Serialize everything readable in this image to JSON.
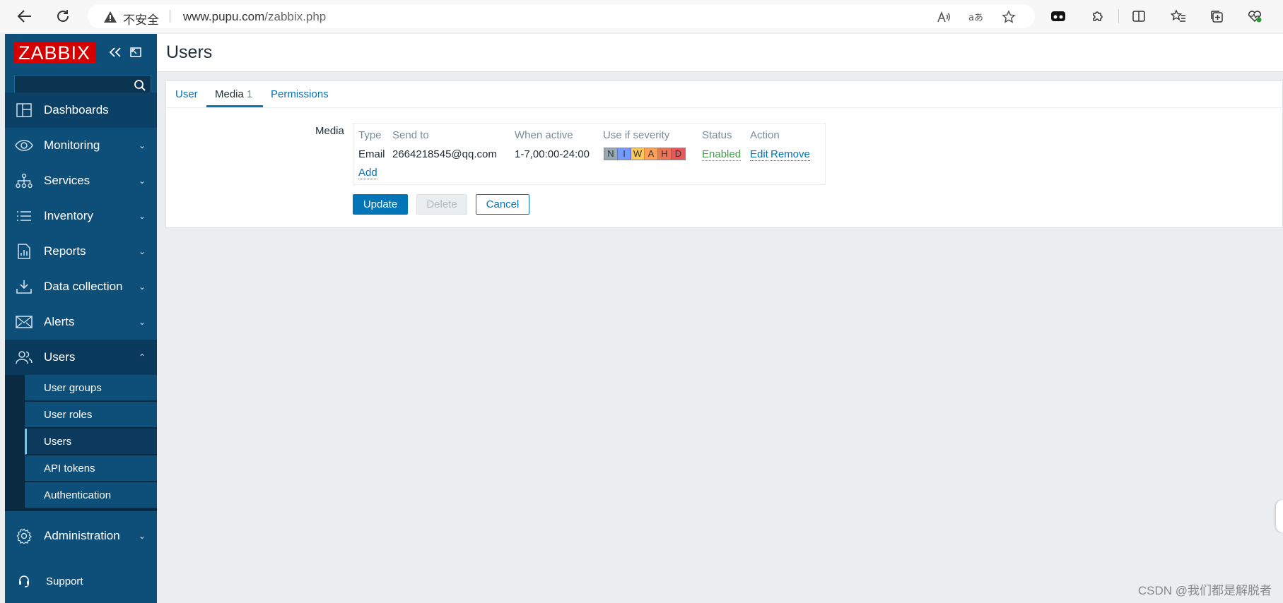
{
  "browser": {
    "security_label": "不安全",
    "url_host": "www.pupu.com",
    "url_path": "/zabbix.php"
  },
  "sidebar": {
    "logo": "ZABBIX",
    "search_placeholder": "",
    "menu": {
      "dashboards": "Dashboards",
      "monitoring": "Monitoring",
      "services": "Services",
      "inventory": "Inventory",
      "reports": "Reports",
      "data_collection": "Data collection",
      "alerts": "Alerts",
      "users": "Users",
      "administration": "Administration"
    },
    "users_sub": {
      "user_groups": "User groups",
      "user_roles": "User roles",
      "users": "Users",
      "api_tokens": "API tokens",
      "authentication": "Authentication"
    },
    "support": "Support"
  },
  "page": {
    "title": "Users"
  },
  "tabs": {
    "user": "User",
    "media": "Media",
    "media_count": "1",
    "permissions": "Permissions"
  },
  "media": {
    "field_label": "Media",
    "headers": {
      "type": "Type",
      "send_to": "Send to",
      "when_active": "When active",
      "severity": "Use if severity",
      "status": "Status",
      "action": "Action"
    },
    "row": {
      "type": "Email",
      "send_to": "2664218545@qq.com",
      "when_active": "1-7,00:00-24:00",
      "severity_letters": [
        "N",
        "I",
        "W",
        "A",
        "H",
        "D"
      ],
      "severity_colors": [
        "#97aab3",
        "#7499ff",
        "#ffc859",
        "#ffa059",
        "#e97659",
        "#e45959"
      ],
      "status": "Enabled",
      "edit": "Edit",
      "remove": "Remove"
    },
    "add": "Add"
  },
  "buttons": {
    "update": "Update",
    "delete": "Delete",
    "cancel": "Cancel"
  },
  "watermark": "CSDN @我们都是解脱者"
}
